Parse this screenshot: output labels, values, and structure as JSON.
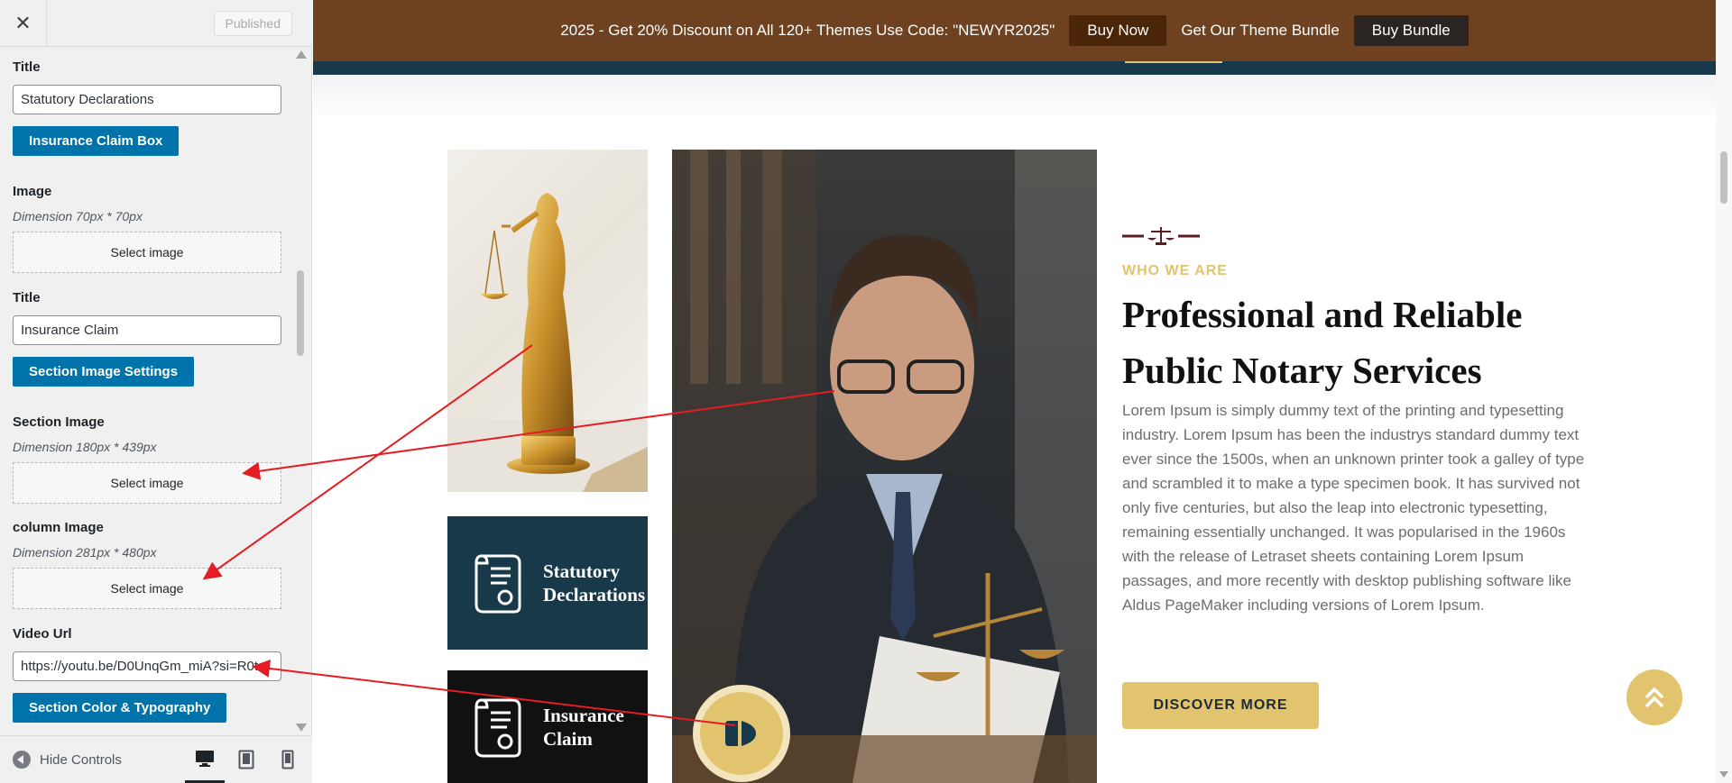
{
  "sidebar": {
    "close_symbol": "✕",
    "published_label": "Published",
    "fields": {
      "title1_label": "Title",
      "title1_value": "Statutory Declarations",
      "insurance_btn": "Insurance Claim Box",
      "image_label": "Image",
      "image_dim": "Dimension 70px * 70px",
      "select_image": "Select image",
      "title2_label": "Title",
      "title2_value": "Insurance Claim",
      "section_image_btn": "Section Image Settings",
      "section_image_label": "Section Image",
      "section_image_dim": "Dimension 180px * 439px",
      "column_image_label": "column Image",
      "column_image_dim": "Dimension 281px * 480px",
      "video_url_label": "Video Url",
      "video_url_value": "https://youtu.be/D0UnqGm_miA?si=R0t",
      "color_typo_btn": "Section Color & Typography"
    },
    "footer": {
      "hide_controls": "Hide Controls",
      "devices": [
        "desktop-icon",
        "tablet-icon",
        "mobile-icon"
      ]
    }
  },
  "preview": {
    "promo_text": "2025 - Get 20% Discount on All 120+ Themes Use Code: \"NEWYR2025\"",
    "buy_now": "Buy Now",
    "bundle_text": "Get Our Theme Bundle",
    "buy_bundle": "Buy Bundle",
    "box_statutory": [
      "Statutory",
      "Declarations"
    ],
    "box_insurance": [
      "Insurance",
      "Claim"
    ],
    "eyebrow": "WHO WE ARE",
    "heading": "Professional and Reliable Public Notary Services",
    "paragraph": "Lorem Ipsum is simply dummy text of the printing and typesetting industry. Lorem Ipsum has been the industrys standard dummy text ever since the 1500s, when an unknown printer took a galley of type and scrambled it to make a type specimen book. It has survived not only five centuries, but also the leap into electronic typesetting, remaining essentially unchanged. It was popularised in the 1960s with the release of Letraset sheets containing Lorem Ipsum passages, and more recently with desktop publishing software like Aldus PageMaker including versions of Lorem Ipsum.",
    "discover": "DISCOVER MORE",
    "colors": {
      "gold": "#e2c36e",
      "navy": "#17394a",
      "brown": "#6e4220",
      "arrow": "#e51c23"
    }
  }
}
